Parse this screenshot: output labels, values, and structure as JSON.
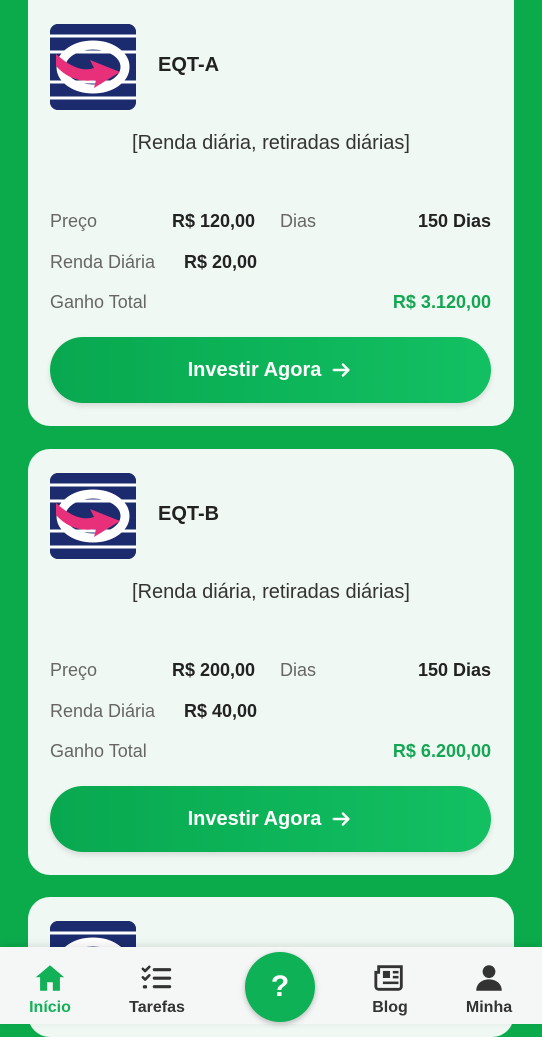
{
  "colors": {
    "background": "#0bab4c",
    "card": "#f0f8f3",
    "accent": "#14a653",
    "button": "#0fb156"
  },
  "products": [
    {
      "name": "EQT-A",
      "description": "[Renda diária, retiradas diárias]",
      "price_label": "Preço",
      "price": "R$ 120,00",
      "days_label": "Dias",
      "days": "150 Dias",
      "daily_label": "Renda Diária",
      "daily": "R$ 20,00",
      "total_label": "Ganho Total",
      "total": "R$ 3.120,00",
      "button_label": "Investir Agora"
    },
    {
      "name": "EQT-B",
      "description": "[Renda diária, retiradas diárias]",
      "price_label": "Preço",
      "price": "R$ 200,00",
      "days_label": "Dias",
      "days": "150 Dias",
      "daily_label": "Renda Diária",
      "daily": "R$ 40,00",
      "total_label": "Ganho Total",
      "total": "R$ 6.200,00",
      "button_label": "Investir Agora"
    }
  ],
  "nav": {
    "items": [
      {
        "label": "Início",
        "icon": "home-icon"
      },
      {
        "label": "Tarefas",
        "icon": "task-list-icon"
      },
      {
        "label": "Blog",
        "icon": "newspaper-icon"
      },
      {
        "label": "Minha",
        "icon": "user-icon"
      }
    ],
    "help_label": "?"
  }
}
